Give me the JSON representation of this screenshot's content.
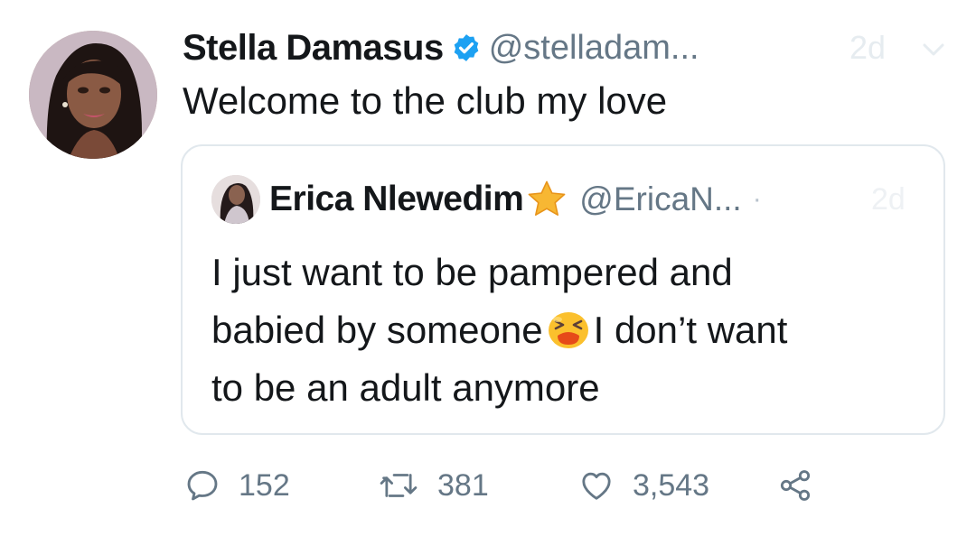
{
  "tweet": {
    "author_name": "Stella Damasus",
    "author_handle": "@stelladam...",
    "time": "2d",
    "text": "Welcome to the club my love"
  },
  "quoted_tweet": {
    "author_name": "Erica Nlewedim",
    "author_handle": "@EricaN...",
    "separator": "·",
    "time": "2d",
    "text_line1": "I just want to be pampered and",
    "text_line2_before_emoji": "babied by someone",
    "text_line2_after_emoji": "I don’t want",
    "text_line3": "to be an adult anymore"
  },
  "actions": {
    "replies": "152",
    "retweets": "381",
    "likes": "3,543"
  },
  "icons": {
    "verified": "verified-badge-icon",
    "star": "star-emoji-icon",
    "emoji": "tired-face-emoji-icon",
    "reply": "reply-icon",
    "retweet": "retweet-icon",
    "like": "heart-icon",
    "share": "share-icon",
    "menu": "chevron-down-icon"
  },
  "colors": {
    "verified_blue": "#1da1f2",
    "secondary_text": "#657786",
    "border": "#e1e8ed"
  }
}
